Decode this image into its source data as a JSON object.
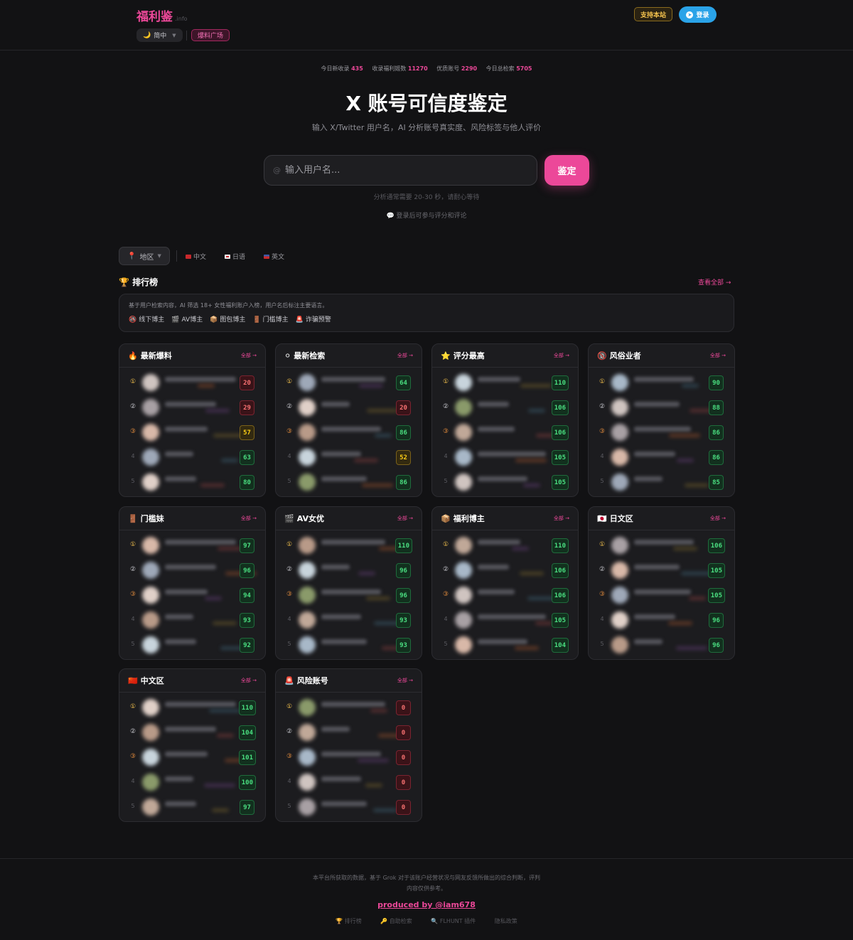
{
  "header": {
    "logo": "福利鉴",
    "logo_suffix": ".info",
    "lang_label": "简中",
    "plaza_label": "爆料广场",
    "support_label": "支持本站",
    "login_label": "登录"
  },
  "stats": [
    {
      "label": "今日新收录",
      "value": "435"
    },
    {
      "label": "收录福利姬数",
      "value": "11270"
    },
    {
      "label": "优质账号",
      "value": "2290"
    },
    {
      "label": "今日总检索",
      "value": "5705"
    }
  ],
  "hero": {
    "title": "X 账号可信度鉴定",
    "subtitle": "输入 X/Twitter 用户名，AI 分析账号真实度、风险标签与他人评价",
    "search_placeholder": "输入用户名...",
    "search_prefix": "@",
    "button_label": "鉴定",
    "wait_note": "分析通常需要 20-30 秒，请耐心等待",
    "login_note": "登录后可参与评分和评论"
  },
  "filters": {
    "region_label": "地区",
    "languages": [
      "中文",
      "日语",
      "英文"
    ]
  },
  "ranking": {
    "title": "排行榜",
    "view_all": "查看全部 →",
    "description": "基于用户检索内容，AI 筛选 18+ 女性福利账户入榜，用户名后标注主要语言。",
    "legend": [
      {
        "icon": "🚳",
        "label": "线下博主"
      },
      {
        "icon": "🎬",
        "label": "AV博主"
      },
      {
        "icon": "📦",
        "label": "图包博主"
      },
      {
        "icon": "🚪",
        "label": "门槛博主"
      },
      {
        "icon": "🚨",
        "label": "诈骗预警"
      }
    ]
  },
  "cards": [
    {
      "icon": "🔥",
      "title": "最新爆料",
      "all": "全部 →",
      "scores": [
        "20",
        "29",
        "57",
        "63",
        "80"
      ],
      "kinds": [
        "red",
        "red",
        "yellow",
        "green",
        "green"
      ]
    },
    {
      "icon": "⚪",
      "title": "最新检索",
      "all": "全部 →",
      "scores": [
        "64",
        "20",
        "86",
        "52",
        "86"
      ],
      "kinds": [
        "green",
        "red",
        "green",
        "yellow",
        "green"
      ]
    },
    {
      "icon": "⭐",
      "title": "评分最高",
      "all": "全部 →",
      "scores": [
        "110",
        "106",
        "106",
        "105",
        "105"
      ],
      "kinds": [
        "green",
        "green",
        "green",
        "green",
        "green"
      ]
    },
    {
      "icon": "🔞",
      "title": "风俗业者",
      "all": "全部 →",
      "scores": [
        "90",
        "88",
        "86",
        "86",
        "85"
      ],
      "kinds": [
        "green",
        "green",
        "green",
        "green",
        "green"
      ]
    },
    {
      "icon": "🚪",
      "title": "门槛妹",
      "all": "全部 →",
      "scores": [
        "97",
        "96",
        "94",
        "93",
        "92"
      ],
      "kinds": [
        "green",
        "green",
        "green",
        "green",
        "green"
      ]
    },
    {
      "icon": "🎬",
      "title": "AV女优",
      "all": "全部 →",
      "scores": [
        "110",
        "96",
        "96",
        "93",
        "93"
      ],
      "kinds": [
        "green",
        "green",
        "green",
        "green",
        "green"
      ]
    },
    {
      "icon": "📦",
      "title": "福利博主",
      "all": "全部 →",
      "scores": [
        "110",
        "106",
        "106",
        "105",
        "104"
      ],
      "kinds": [
        "green",
        "green",
        "green",
        "green",
        "green"
      ]
    },
    {
      "icon": "🇯🇵",
      "title": "日文区",
      "all": "全部 →",
      "scores": [
        "106",
        "105",
        "105",
        "96",
        "96"
      ],
      "kinds": [
        "green",
        "green",
        "green",
        "green",
        "green"
      ]
    },
    {
      "icon": "🇨🇳",
      "title": "中文区",
      "all": "全部 →",
      "scores": [
        "110",
        "104",
        "101",
        "100",
        "97"
      ],
      "kinds": [
        "green",
        "green",
        "green",
        "green",
        "green"
      ]
    },
    {
      "icon": "🚨",
      "title": "风险账号",
      "all": "全部 →",
      "scores": [
        "0",
        "0",
        "0",
        "0",
        "0"
      ],
      "kinds": [
        "red",
        "red",
        "red",
        "red",
        "red"
      ]
    }
  ],
  "ranks": [
    "①",
    "②",
    "③",
    "4",
    "5"
  ],
  "footer": {
    "disclaimer": "本平台所获取的数据，基于 Grok 对于该账户经营状况与网友反馈所做出的综合判断，评判内容仅供参考。",
    "produced": "produced by @iam678",
    "links": [
      "🏆 排行榜",
      "🔑 自助检索",
      "🔍 FLHUNT 插件",
      "隐私政策"
    ]
  },
  "colors": {
    "accent": "#ec4899",
    "score_green": "#4ade80",
    "score_red": "#f87171",
    "score_yellow": "#facc15",
    "telegram": "#2aa3e8"
  }
}
